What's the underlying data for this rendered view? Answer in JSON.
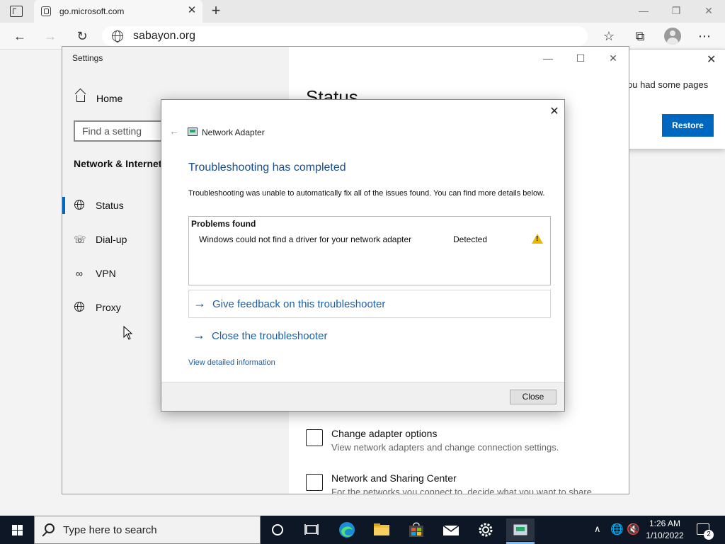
{
  "browser": {
    "tab_title": "go.microsoft.com",
    "tab_close": "✕",
    "new_tab": "+",
    "url": "sabayon.org",
    "window_controls": {
      "minimize": "—",
      "maximize": "❐",
      "close": "✕"
    },
    "restore_popup": {
      "text": "ou had some pages",
      "restore_label": "Restore",
      "close": "✕"
    }
  },
  "settings": {
    "window_title": "Settings",
    "home_label": "Home",
    "search_placeholder": "Find a setting",
    "section_title": "Network & Internet",
    "nav": [
      {
        "label": "Status",
        "icon": "globe-icon",
        "active": true
      },
      {
        "label": "Dial-up",
        "icon": "phone-icon"
      },
      {
        "label": "VPN",
        "icon": "vpn-icon"
      },
      {
        "label": "Proxy",
        "icon": "globe-icon"
      }
    ],
    "right": {
      "heading": "Status",
      "links": [
        {
          "title": "Change adapter options",
          "subtitle": "View network adapters and change connection settings."
        },
        {
          "title": "Network and Sharing Center",
          "subtitle": "For the networks you connect to, decide what you want to share."
        }
      ]
    }
  },
  "dialog": {
    "title": "Network Adapter",
    "heading": "Troubleshooting has completed",
    "description": "Troubleshooting was unable to automatically fix all of the issues found. You can find more details below.",
    "problems_header": "Problems found",
    "problems": [
      {
        "text": "Windows could not find a driver for your network adapter",
        "status": "Detected",
        "icon": "warning-icon"
      }
    ],
    "links": {
      "feedback": "Give feedback on this troubleshooter",
      "close": "Close the troubleshooter",
      "details": "View detailed information"
    },
    "close_button": "Close",
    "close_x": "✕",
    "back_arrow": "←"
  },
  "taskbar": {
    "search_placeholder": "Type here to search",
    "time": "1:26 AM",
    "date": "1/10/2022",
    "notification_count": "2"
  },
  "colors": {
    "accent": "#0067c0",
    "dialog_heading": "#1a4e8c",
    "taskbar": "#0e1726"
  }
}
